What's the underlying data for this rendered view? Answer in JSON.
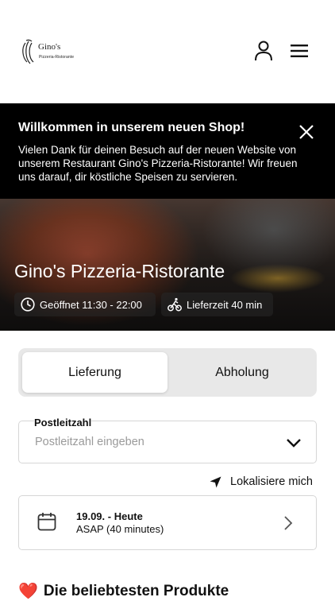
{
  "logo": {
    "name": "Gino's",
    "subtitle": "Pizzeria-Ristorante"
  },
  "header": {
    "user_icon": "user-icon",
    "menu_icon": "menu-icon"
  },
  "banner": {
    "title": "Willkommen in unserem neuen Shop!",
    "text": "Vielen Dank für deinen Besuch auf der neuen Website von unserem Restaurant Gino's Pizzeria-Ristorante! Wir freuen uns darauf, dir köstliche Speisen zu servieren.",
    "close_icon": "close-icon"
  },
  "hero": {
    "title": "Gino's Pizzeria-Ristorante",
    "opening_hours": "Geöffnet 11:30 - 22:00",
    "delivery_time": "Lieferzeit 40 min"
  },
  "order_mode": {
    "delivery_label": "Lieferung",
    "pickup_label": "Abholung",
    "selected": "Lieferung"
  },
  "postcode": {
    "label": "Postleitzahl",
    "placeholder": "Postleitzahl eingeben",
    "value": ""
  },
  "locate": {
    "label": "Lokalisiere mich"
  },
  "timeslot": {
    "date": "19.09. - Heute",
    "time": "ASAP (40 minutes)"
  },
  "popular": {
    "icon": "❤️",
    "title": "Die beliebtesten Produkte"
  },
  "colors": {
    "banner_bg": "#000000",
    "toggle_bg": "#e8e8e8",
    "border": "#d6d6d6",
    "heart": "#d91f1f"
  }
}
